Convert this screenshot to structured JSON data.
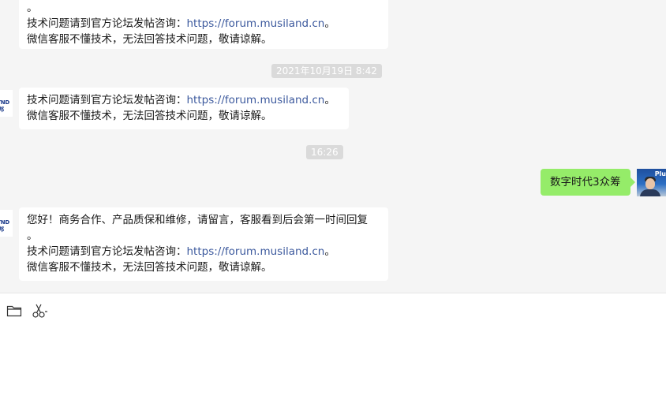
{
  "messages": {
    "first": {
      "line0": "。",
      "line1_prefix": "技术问题请到官方论坛发帖咨询：",
      "line1_link": "https://forum.musiland.cn",
      "line1_suffix": "。",
      "line2": "微信客服不懂技术，无法回答技术问题，敬请谅解。"
    },
    "timestamp1": "2021年10月19日 8:42",
    "second": {
      "line1_prefix": "技术问题请到官方论坛发帖咨询：",
      "line1_link": "https://forum.musiland.cn",
      "line1_suffix": "。",
      "line2": "微信客服不懂技术，无法回答技术问题，敬请谅解。"
    },
    "timestamp2": "16:26",
    "sent": "数字时代3众筹",
    "third": {
      "line1": "您好！商务合作、产品质保和维修，请留言，客服看到后会第一时间回复",
      "line2": "。",
      "line3_prefix": "技术问题请到官方论坛发帖咨询：",
      "line3_link": "https://forum.musiland.cn",
      "line3_suffix": "。",
      "line4": "微信客服不懂技术，无法回答技术问题，敬请谅解。"
    }
  },
  "avatars": {
    "left_logo_text": "YND\n邦",
    "right_tag": "Plu"
  },
  "toolbar": {
    "icons": [
      "folder-icon",
      "scissors-icon"
    ]
  },
  "colors": {
    "chat_bg": "#f5f5f5",
    "sent_bubble": "#95ec69",
    "link": "#3d5a9e",
    "timestamp_bg": "#dadada"
  }
}
